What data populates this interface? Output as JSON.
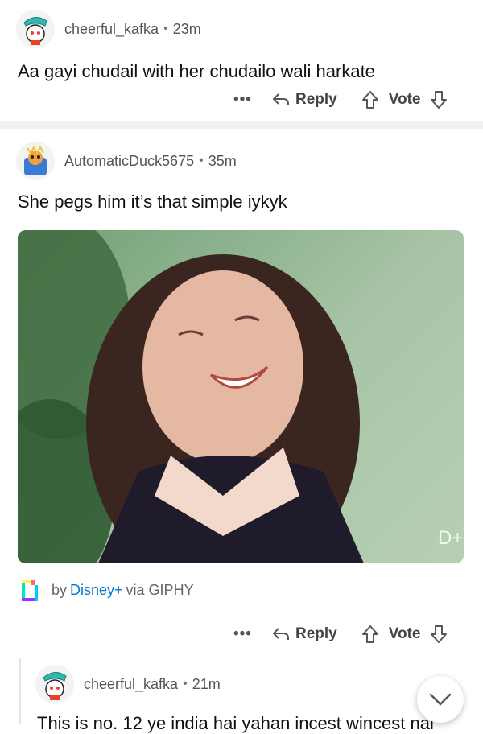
{
  "comments": [
    {
      "username": "cheerful_kafka",
      "separator": "•",
      "time": "23m",
      "text": "Aa gayi chudail with her chudailo wali harkate",
      "actions": {
        "more": "•••",
        "reply": "Reply",
        "vote": "Vote"
      }
    },
    {
      "username": "AutomaticDuck5675",
      "separator": "•",
      "time": "35m",
      "text": "She pegs him it’s that simple iykyk",
      "gif": {
        "by_label": "by",
        "source": "Disney+",
        "via_label": "via GIPHY",
        "watermark": "D+"
      },
      "actions": {
        "more": "•••",
        "reply": "Reply",
        "vote": "Vote"
      }
    },
    {
      "username": "cheerful_kafka",
      "separator": "•",
      "time": "21m",
      "text": "This is no. 12 ye india hai yahan incest wincest nai"
    }
  ],
  "colors": {
    "link": "#0079d3",
    "muted": "#555555",
    "separator": "#f0f0f0"
  }
}
